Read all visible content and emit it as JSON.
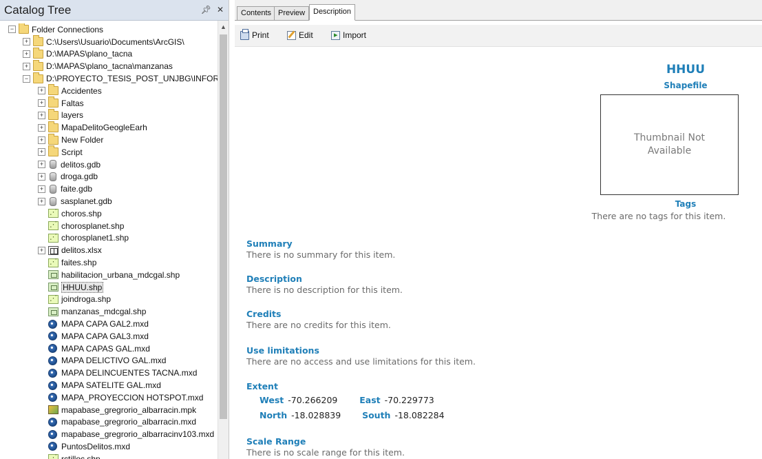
{
  "catalog": {
    "title": "Catalog Tree",
    "pin_icon": "pin-icon",
    "close_icon": "close-icon",
    "items": [
      {
        "label": "Folder Connections",
        "expander": "−",
        "icon": "folder",
        "level": 0
      },
      {
        "label": "C:\\Users\\Usuario\\Documents\\ArcGIS\\",
        "expander": "+",
        "icon": "folder",
        "level": 1
      },
      {
        "label": "D:\\MAPAS\\plano_tacna",
        "expander": "+",
        "icon": "folder",
        "level": 1
      },
      {
        "label": "D:\\MAPAS\\plano_tacna\\manzanas",
        "expander": "+",
        "icon": "folder",
        "level": 1
      },
      {
        "label": "D:\\PROYECTO_TESIS_POST_UNJBG\\INFORMI",
        "expander": "−",
        "icon": "folder",
        "level": 1
      },
      {
        "label": "Accidentes",
        "expander": "+",
        "icon": "folder",
        "level": 2
      },
      {
        "label": "Faltas",
        "expander": "+",
        "icon": "folder",
        "level": 2
      },
      {
        "label": "layers",
        "expander": "+",
        "icon": "folder",
        "level": 2
      },
      {
        "label": "MapaDelitoGeogleEarh",
        "expander": "+",
        "icon": "folder",
        "level": 2
      },
      {
        "label": "New Folder",
        "expander": "+",
        "icon": "folder",
        "level": 2
      },
      {
        "label": "Script",
        "expander": "+",
        "icon": "folder",
        "level": 2
      },
      {
        "label": "delitos.gdb",
        "expander": "+",
        "icon": "database",
        "level": 2
      },
      {
        "label": "droga.gdb",
        "expander": "+",
        "icon": "database",
        "level": 2
      },
      {
        "label": "faite.gdb",
        "expander": "+",
        "icon": "database",
        "level": 2
      },
      {
        "label": "sasplanet.gdb",
        "expander": "+",
        "icon": "database",
        "level": 2
      },
      {
        "label": "choros.shp",
        "expander": "",
        "icon": "point-shapefile",
        "level": 2
      },
      {
        "label": "chorosplanet.shp",
        "expander": "",
        "icon": "point-shapefile",
        "level": 2
      },
      {
        "label": "chorosplanet1.shp",
        "expander": "",
        "icon": "point-shapefile",
        "level": 2
      },
      {
        "label": "delitos.xlsx",
        "expander": "+",
        "icon": "table",
        "level": 2
      },
      {
        "label": "faites.shp",
        "expander": "",
        "icon": "point-shapefile",
        "level": 2
      },
      {
        "label": "habilitacion_urbana_mdcgal.shp",
        "expander": "",
        "icon": "polygon-shapefile",
        "level": 2
      },
      {
        "label": "HHUU.shp",
        "expander": "",
        "icon": "polygon-shapefile",
        "level": 2,
        "selected": true
      },
      {
        "label": "joindroga.shp",
        "expander": "",
        "icon": "point-shapefile",
        "level": 2
      },
      {
        "label": "manzanas_mdcgal.shp",
        "expander": "",
        "icon": "polygon-shapefile",
        "level": 2
      },
      {
        "label": "MAPA CAPA GAL2.mxd",
        "expander": "",
        "icon": "map-document",
        "level": 2
      },
      {
        "label": "MAPA CAPA GAL3.mxd",
        "expander": "",
        "icon": "map-document",
        "level": 2
      },
      {
        "label": "MAPA CAPAS GAL.mxd",
        "expander": "",
        "icon": "map-document",
        "level": 2
      },
      {
        "label": "MAPA DELICTIVO GAL.mxd",
        "expander": "",
        "icon": "map-document",
        "level": 2
      },
      {
        "label": "MAPA DELINCUENTES TACNA.mxd",
        "expander": "",
        "icon": "map-document",
        "level": 2
      },
      {
        "label": "MAPA SATELITE GAL.mxd",
        "expander": "",
        "icon": "map-document",
        "level": 2
      },
      {
        "label": "MAPA_PROYECCION HOTSPOT.mxd",
        "expander": "",
        "icon": "map-document",
        "level": 2
      },
      {
        "label": "mapabase_gregrorio_albarracin.mpk",
        "expander": "",
        "icon": "map-package",
        "level": 2
      },
      {
        "label": "mapabase_gregrorio_albarracin.mxd",
        "expander": "",
        "icon": "map-document",
        "level": 2
      },
      {
        "label": "mapabase_gregrorio_albarracinv103.mxd",
        "expander": "",
        "icon": "map-document",
        "level": 2
      },
      {
        "label": "PuntosDelitos.mxd",
        "expander": "",
        "icon": "map-document",
        "level": 2
      },
      {
        "label": "rctilloc.shp",
        "expander": "",
        "icon": "point-shapefile",
        "level": 2
      }
    ]
  },
  "tabs": [
    {
      "label": "Contents",
      "active": false
    },
    {
      "label": "Preview",
      "active": false
    },
    {
      "label": "Description",
      "active": true
    }
  ],
  "toolbar": {
    "print_label": "Print",
    "edit_label": "Edit",
    "import_label": "Import"
  },
  "description": {
    "title": "HHUU",
    "subtitle": "Shapefile",
    "thumbnail_text": "Thumbnail Not Available",
    "tags_heading": "Tags",
    "tags_text": "There are no tags for this item.",
    "summary_heading": "Summary",
    "summary_text": "There is no summary for this item.",
    "description_heading": "Description",
    "description_text": "There is no description for this item.",
    "credits_heading": "Credits",
    "credits_text": "There are no credits for this item.",
    "use_limitations_heading": "Use limitations",
    "use_limitations_text": "There are no access and use limitations for this item.",
    "extent_heading": "Extent",
    "extent": {
      "west_label": "West",
      "west_value": "-70.266209",
      "east_label": "East",
      "east_value": "-70.229773",
      "north_label": "North",
      "north_value": "-18.028839",
      "south_label": "South",
      "south_value": "-18.082284"
    },
    "scale_range_heading": "Scale Range",
    "scale_range_text": "There is no scale range for this item."
  },
  "colors": {
    "heading_blue": "#1f7fb8",
    "body_gray": "#6a6a6a",
    "panel_header": "#dbe3ee"
  }
}
